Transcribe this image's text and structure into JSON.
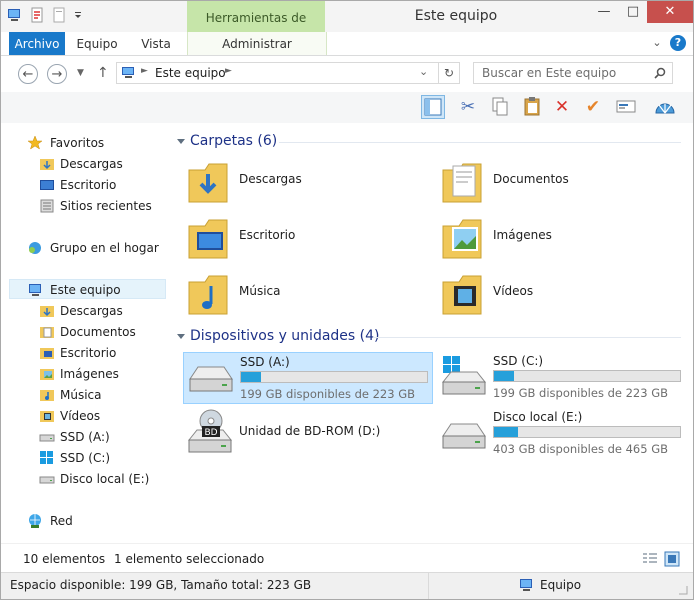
{
  "window": {
    "title": "Este equipo",
    "context_tab": "Herramientas de unidad"
  },
  "ribbon": {
    "tabs": [
      "Archivo",
      "Equipo",
      "Vista"
    ],
    "context_sub": "Administrar"
  },
  "address": {
    "path": "Este equipo",
    "search_placeholder": "Buscar en Este equipo"
  },
  "nav": {
    "favorites_label": "Favoritos",
    "favorites": [
      "Descargas",
      "Escritorio",
      "Sitios recientes"
    ],
    "homegroup": "Grupo en el hogar",
    "this_pc": "Este equipo",
    "pc_items": [
      "Descargas",
      "Documentos",
      "Escritorio",
      "Imágenes",
      "Música",
      "Vídeos",
      "SSD (A:)",
      "SSD (C:)",
      "Disco local (E:)"
    ],
    "network": "Red"
  },
  "folders": {
    "header": "Carpetas (6)",
    "items": [
      "Descargas",
      "Documentos",
      "Escritorio",
      "Imágenes",
      "Música",
      "Vídeos"
    ]
  },
  "devices": {
    "header": "Dispositivos y unidades (4)",
    "items": [
      {
        "name": "SSD (A:)",
        "detail": "199 GB disponibles de 223 GB",
        "used": 0.11
      },
      {
        "name": "SSD (C:)",
        "detail": "199 GB disponibles de 223 GB",
        "used": 0.11
      },
      {
        "name": "Unidad de BD-ROM (D:)"
      },
      {
        "name": "Disco local (E:)",
        "detail": "403 GB disponibles de 465 GB",
        "used": 0.13
      }
    ],
    "bd_badge": "BD"
  },
  "status": {
    "count": "10 elementos",
    "selected": "1 elemento seleccionado"
  },
  "details": {
    "space": "Espacio disponible: 199 GB, Tamaño total: 223 GB",
    "location": "Equipo"
  },
  "colors": {
    "accent": "#1979ca",
    "context": "#c6e5a9",
    "selection": "#cce8ff",
    "bar": "#26a0da",
    "close": "#c7504d"
  }
}
